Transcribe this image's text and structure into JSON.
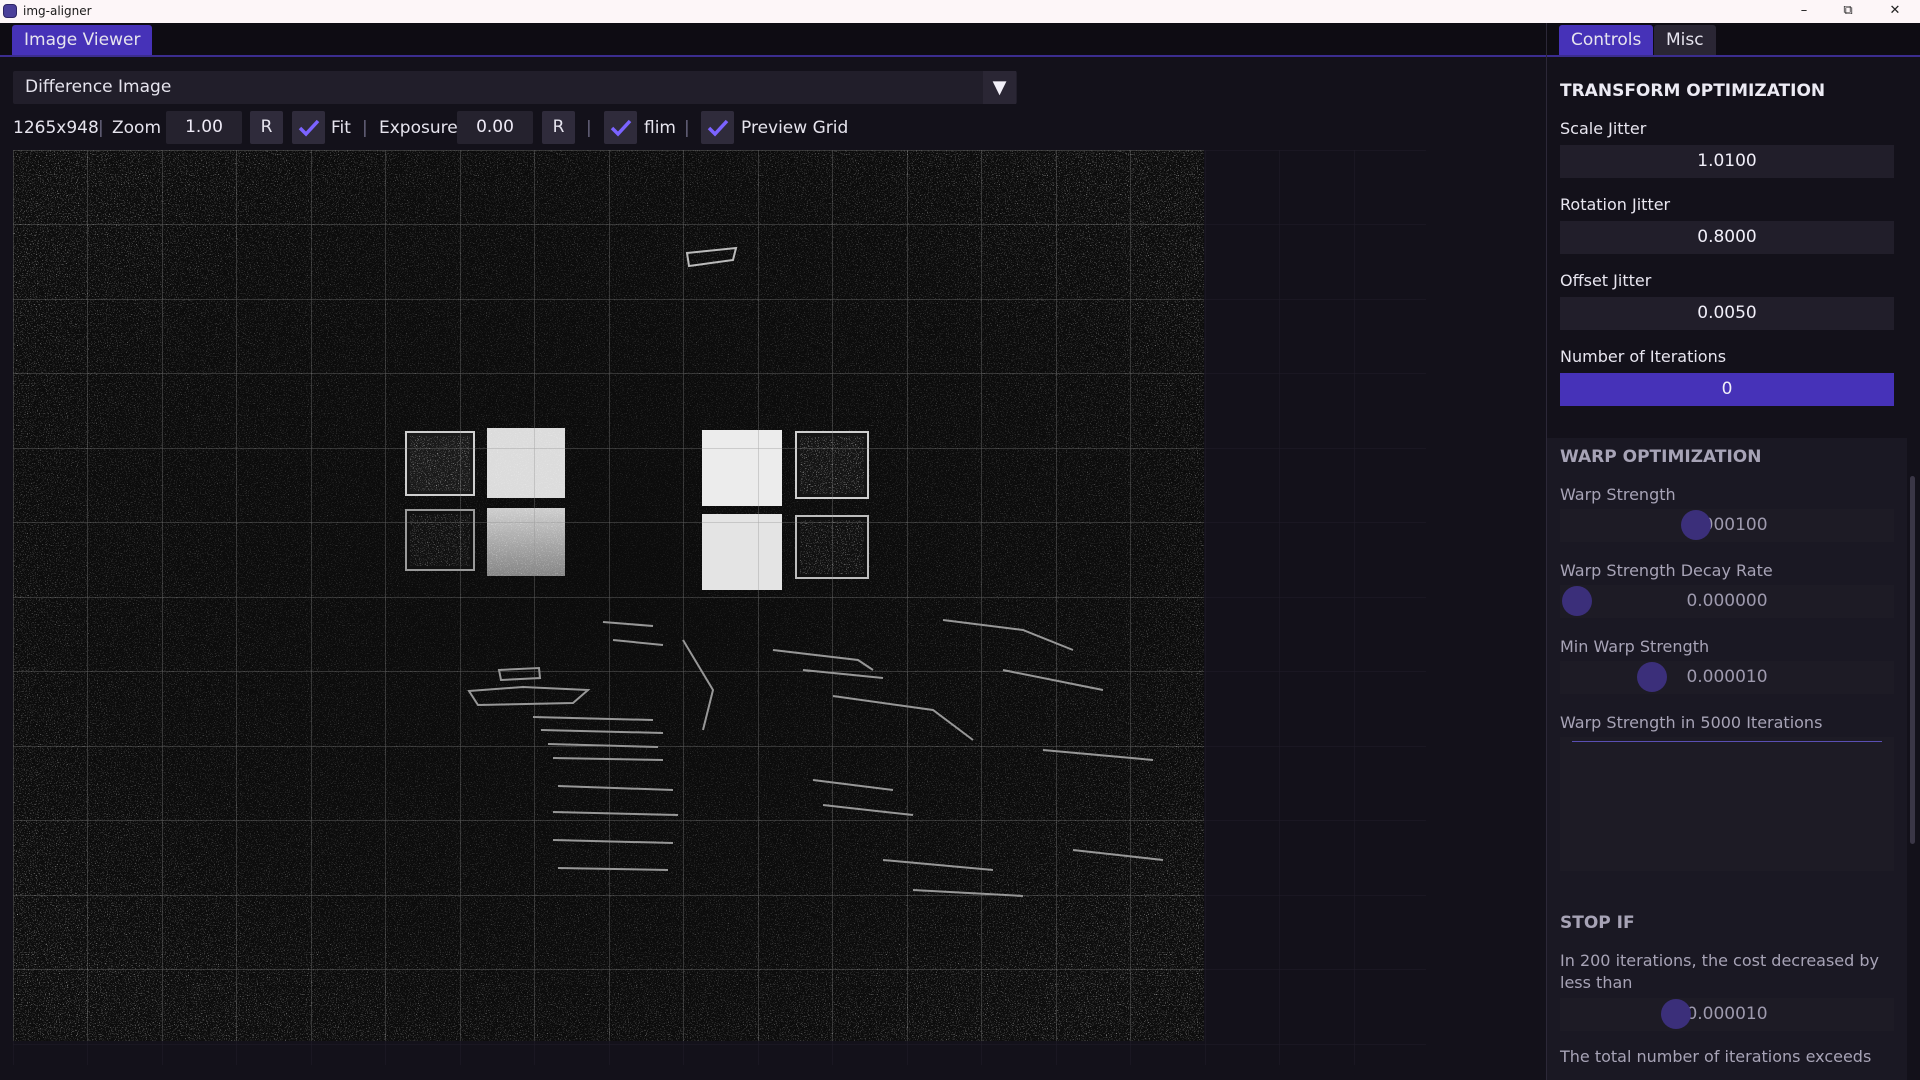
{
  "window": {
    "title": "img-aligner",
    "minimize": "–",
    "maximize": "⧉",
    "close": "✕"
  },
  "left_tabs": [
    {
      "label": "Image Viewer"
    }
  ],
  "view_mode": {
    "selected": "Difference Image",
    "arrow": "▼"
  },
  "toolbar": {
    "dimensions": "1265x948",
    "sep": "|",
    "zoom_label": "Zoom",
    "zoom_value": "1.00",
    "reset_label": "R",
    "fit_label": "Fit",
    "fit_checked": true,
    "exposure_label": "Exposure",
    "exposure_value": "0.00",
    "flim_label": "flim",
    "flim_checked": true,
    "preview_grid_label": "Preview Grid",
    "preview_grid_checked": true
  },
  "right_tabs": [
    {
      "label": "Controls",
      "active": true
    },
    {
      "label": "Misc",
      "active": false
    }
  ],
  "transform": {
    "title": "TRANSFORM OPTIMIZATION",
    "scale_jitter_label": "Scale Jitter",
    "scale_jitter": "1.0100",
    "rotation_jitter_label": "Rotation Jitter",
    "rotation_jitter": "0.8000",
    "offset_jitter_label": "Offset Jitter",
    "offset_jitter": "0.0050",
    "iterations_label": "Number of Iterations",
    "iterations": "0"
  },
  "warp": {
    "title": "WARP OPTIMIZATION",
    "strength_label": "Warp Strength",
    "strength": "0.000100",
    "decay_label": "Warp Strength Decay Rate",
    "decay": "0.000000",
    "min_label": "Min Warp Strength",
    "min": "0.000010",
    "plot_label": "Warp Strength in 5000 Iterations"
  },
  "stop_if": {
    "title": "STOP IF",
    "cost_label": "In 200 iterations, the cost decreased by less than",
    "cost_value": "0.000010",
    "total_label": "The total number of iterations exceeds"
  },
  "colors": {
    "accent": "#4632b8",
    "panel": "#13111a",
    "field": "#211e2a"
  }
}
